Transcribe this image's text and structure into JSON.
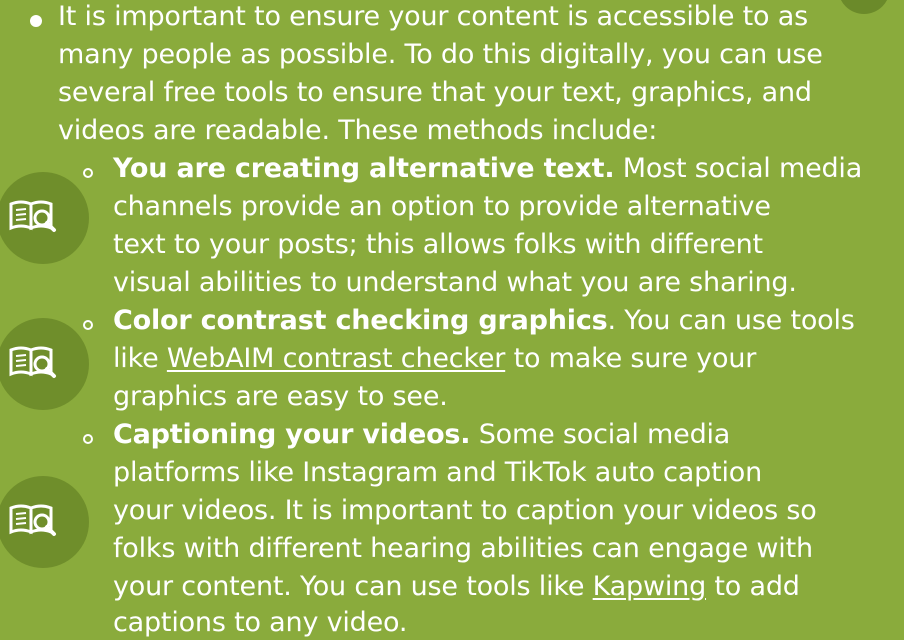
{
  "colors": {
    "background": "#8aab3c",
    "badge": "#6f8e2b",
    "text": "#ffffff"
  },
  "icons": [
    "open-book-magnifier-icon"
  ],
  "intro": {
    "lines": [
      "It is important to ensure your content is accessible to as",
      "many people as possible. To do this digitally, you can use",
      "several free tools to ensure that your text, graphics, and",
      "videos are readable. These methods include:"
    ]
  },
  "items": [
    {
      "title": "You are creating alternative text.",
      "line1_rest": " Most social media",
      "lines": [
        "channels provide an option to provide alternative",
        "text to your posts; this allows folks with different",
        "visual abilities to understand what you are sharing."
      ]
    },
    {
      "title": "Color contrast checking graphics",
      "line1_rest": ". You can use tools",
      "line2_pre": "like ",
      "link": "WebAIM contrast checker",
      "line2_post": " to make sure your",
      "line3": "graphics are easy to see."
    },
    {
      "title": "Captioning your videos.",
      "line1_rest": " Some social media",
      "lines": [
        "platforms like Instagram and TikTok auto caption",
        "your videos. It is important to caption your videos so",
        "folks with different hearing abilities can engage with"
      ],
      "line5_pre": "your content. You can use tools like ",
      "link": "Kapwing",
      "line5_post": " to add",
      "line6": "captions to any video."
    }
  ]
}
